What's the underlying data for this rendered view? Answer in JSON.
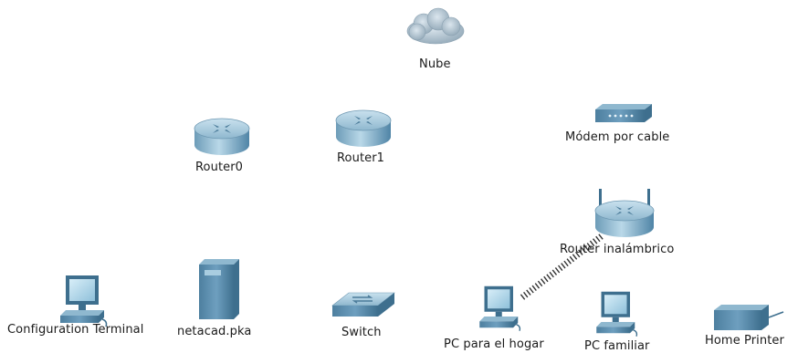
{
  "canvas": {
    "background": "#ffffff"
  },
  "devices": {
    "cloud": {
      "label": "Nube",
      "icon": "cloud-icon"
    },
    "router0": {
      "label": "Router0",
      "icon": "router-icon"
    },
    "router1": {
      "label": "Router1",
      "icon": "router-icon"
    },
    "modem": {
      "label": "Módem por cable",
      "icon": "cable-modem-icon"
    },
    "wireless_router": {
      "label": "Router inalámbrico",
      "icon": "wireless-router-icon"
    },
    "config_terminal": {
      "label": "Configuration Terminal",
      "icon": "pc-icon"
    },
    "server": {
      "label": "netacad.pka",
      "icon": "server-icon"
    },
    "switch": {
      "label": "Switch",
      "icon": "switch-icon"
    },
    "pc_home": {
      "label": "PC para el hogar",
      "icon": "pc-icon"
    },
    "pc_family": {
      "label": "PC familiar",
      "icon": "pc-icon"
    },
    "printer": {
      "label": "Home Printer",
      "icon": "printer-icon"
    }
  },
  "links": [
    {
      "from": "pc_home",
      "to": "wireless_router",
      "type": "wireless"
    }
  ],
  "colors": {
    "device_blue": "#5b8fb0",
    "device_dark": "#3f6f8f",
    "device_light": "#a9cde0",
    "link": "#333333"
  }
}
